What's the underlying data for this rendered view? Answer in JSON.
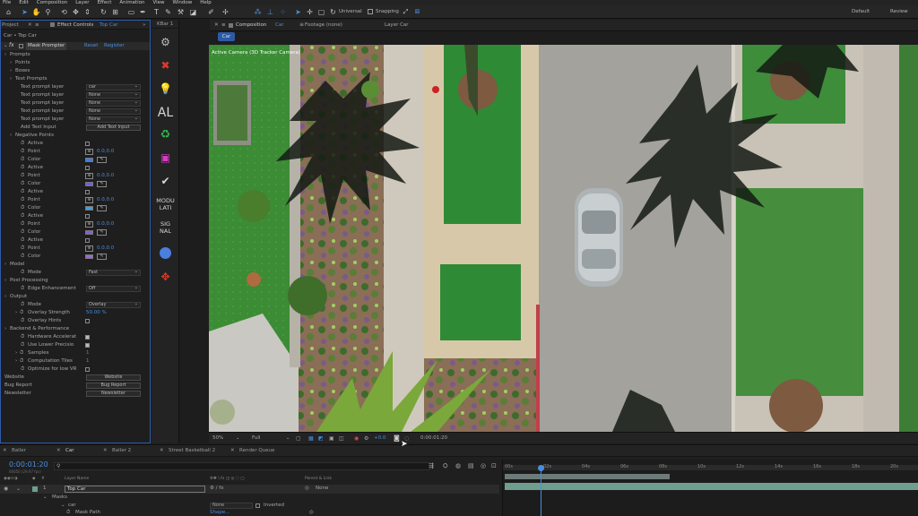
{
  "menu": [
    "File",
    "Edit",
    "Composition",
    "Layer",
    "Effect",
    "Animation",
    "View",
    "Window",
    "Help"
  ],
  "toolbar": {
    "universal": "Universal",
    "snapping": "Snapping",
    "workspace_default": "Default",
    "workspace_review": "Review"
  },
  "project_tab": "Project",
  "effect_controls": {
    "tab_label": "Effect Controls",
    "tab_layer": "Top Car",
    "source": "Car • Top Car",
    "effect_name": "Mask Prompter",
    "reset": "Reset",
    "register": "Register",
    "rows": [
      {
        "lbl": "Prompts",
        "indent": 0,
        "twirl": true
      },
      {
        "lbl": "Points",
        "indent": 1,
        "twirl": true
      },
      {
        "lbl": "Boxes",
        "indent": 1,
        "twirl": true
      },
      {
        "lbl": "Text Prompts",
        "indent": 1,
        "twirl": true
      },
      {
        "lbl": "Text prompt layer",
        "indent": 3,
        "ctl": "ddl",
        "val": "car"
      },
      {
        "lbl": "Text prompt layer",
        "indent": 3,
        "ctl": "ddl",
        "val": "None"
      },
      {
        "lbl": "Text prompt layer",
        "indent": 3,
        "ctl": "ddl",
        "val": "None"
      },
      {
        "lbl": "Text prompt layer",
        "indent": 3,
        "ctl": "ddl",
        "val": "None"
      },
      {
        "lbl": "Text prompt layer",
        "indent": 3,
        "ctl": "ddl",
        "val": "None"
      },
      {
        "lbl": "Add Text Input",
        "indent": 3,
        "ctl": "btn",
        "val": "Add Text Input"
      },
      {
        "lbl": "Negative Points",
        "indent": 1,
        "twirl": true
      },
      {
        "lbl": "Active",
        "indent": 3,
        "stop": true,
        "ctl": "chk"
      },
      {
        "lbl": "Point",
        "indent": 3,
        "stop": true,
        "ctl": "pt",
        "val": "0.0,0.0"
      },
      {
        "lbl": "Color",
        "indent": 3,
        "stop": true,
        "ctl": "col",
        "color": "#3f7fe0"
      },
      {
        "lbl": "Active",
        "indent": 3,
        "stop": true,
        "ctl": "chk"
      },
      {
        "lbl": "Point",
        "indent": 3,
        "stop": true,
        "ctl": "pt",
        "val": "0.0,0.0"
      },
      {
        "lbl": "Color",
        "indent": 3,
        "stop": true,
        "ctl": "col",
        "color": "#7b5be0"
      },
      {
        "lbl": "Active",
        "indent": 3,
        "stop": true,
        "ctl": "chk"
      },
      {
        "lbl": "Point",
        "indent": 3,
        "stop": true,
        "ctl": "pt",
        "val": "0.0,0.0"
      },
      {
        "lbl": "Color",
        "indent": 3,
        "stop": true,
        "ctl": "col",
        "color": "#3fa0e0"
      },
      {
        "lbl": "Active",
        "indent": 3,
        "stop": true,
        "ctl": "chk"
      },
      {
        "lbl": "Point",
        "indent": 3,
        "stop": true,
        "ctl": "pt",
        "val": "0.0,0.0"
      },
      {
        "lbl": "Color",
        "indent": 3,
        "stop": true,
        "ctl": "col",
        "color": "#8a5be0"
      },
      {
        "lbl": "Active",
        "indent": 3,
        "stop": true,
        "ctl": "chk"
      },
      {
        "lbl": "Point",
        "indent": 3,
        "stop": true,
        "ctl": "pt",
        "val": "0.0,0.0"
      },
      {
        "lbl": "Color",
        "indent": 3,
        "stop": true,
        "ctl": "col",
        "color": "#9a6ad8"
      },
      {
        "lbl": "Model",
        "indent": 0,
        "twirl": true
      },
      {
        "lbl": "Mode",
        "indent": 3,
        "stop": true,
        "ctl": "ddl",
        "val": "Fast"
      },
      {
        "lbl": "Post Processing",
        "indent": 0,
        "twirl": true
      },
      {
        "lbl": "Edge Enhancement",
        "indent": 3,
        "stop": true,
        "ctl": "ddl",
        "val": "Off"
      },
      {
        "lbl": "Output",
        "indent": 0,
        "twirl": true
      },
      {
        "lbl": "Mode",
        "indent": 3,
        "stop": true,
        "ctl": "ddl",
        "val": "Overlay"
      },
      {
        "lbl": "Overlay Strength",
        "indent": 2,
        "stop": true,
        "twirl": true,
        "ctl": "num",
        "val": "50.00 %"
      },
      {
        "lbl": "Overlay Hints",
        "indent": 3,
        "stop": true,
        "ctl": "chk"
      },
      {
        "lbl": "Backend & Performance",
        "indent": 0,
        "twirl": true
      },
      {
        "lbl": "Hardware Accelerat",
        "indent": 3,
        "stop": true,
        "ctl": "chk",
        "on": true
      },
      {
        "lbl": "Use Lower Precisio",
        "indent": 3,
        "stop": true,
        "ctl": "chk",
        "on": true
      },
      {
        "lbl": "Samples",
        "indent": 2,
        "stop": true,
        "twirl": true,
        "ctl": "num",
        "val": "1"
      },
      {
        "lbl": "Computation Tiles",
        "indent": 2,
        "stop": true,
        "twirl": true,
        "ctl": "num",
        "val": "1"
      },
      {
        "lbl": "Optimize for low VR",
        "indent": 3,
        "stop": true,
        "ctl": "chk"
      },
      {
        "lbl": "Website",
        "indent": 0,
        "ctl": "btn",
        "val": "Website"
      },
      {
        "lbl": "Bug Report",
        "indent": 0,
        "ctl": "btn",
        "val": "Bug Report"
      },
      {
        "lbl": "Newsletter",
        "indent": 0,
        "ctl": "btn",
        "val": "Newsletter"
      }
    ]
  },
  "kbar": {
    "title": "KBar 1",
    "al": "AL",
    "modulation": [
      "MODU",
      "LATI"
    ],
    "signal": [
      "SIG",
      "NAL"
    ]
  },
  "composition": {
    "tab_label": "Composition",
    "tab_name": "Car",
    "footage": "Footage (none)",
    "layer": "Layer Car",
    "subtab": "Car",
    "camera_label": "Active Camera (3D Tracker Camera)"
  },
  "viewer_bar": {
    "zoom": "50%",
    "quality": "Full",
    "exposure": "+0.0",
    "timecode": "0:00:01:20"
  },
  "timeline": {
    "tabs": [
      "Baller",
      "Car",
      "Baller 2",
      "Street Basketball 2",
      "Render Queue"
    ],
    "active_tab": 1,
    "timecode": "0:00:01:20",
    "frames": "00050 (29.97 fps)",
    "layer_name_header": "Layer Name",
    "parent_header": "Parent & Link",
    "layer_number": "1",
    "layer_name": "Top Car",
    "parent_value": "None",
    "masks_label": "Masks",
    "mask_name": "car",
    "mask_mode": "None",
    "mask_inverted": "Inverted",
    "mask_path_label": "Mask Path",
    "mask_path_value": "Shape...",
    "ruler": [
      "00s",
      "02s",
      "04s",
      "06s",
      "08s",
      "10s",
      "12s",
      "14s",
      "16s",
      "18s",
      "20s"
    ],
    "playhead_fraction": 0.09
  },
  "colors": {
    "accent": "#4a8de0",
    "panel": "#1e1e1e",
    "layer_bar": "#6f9e91"
  }
}
